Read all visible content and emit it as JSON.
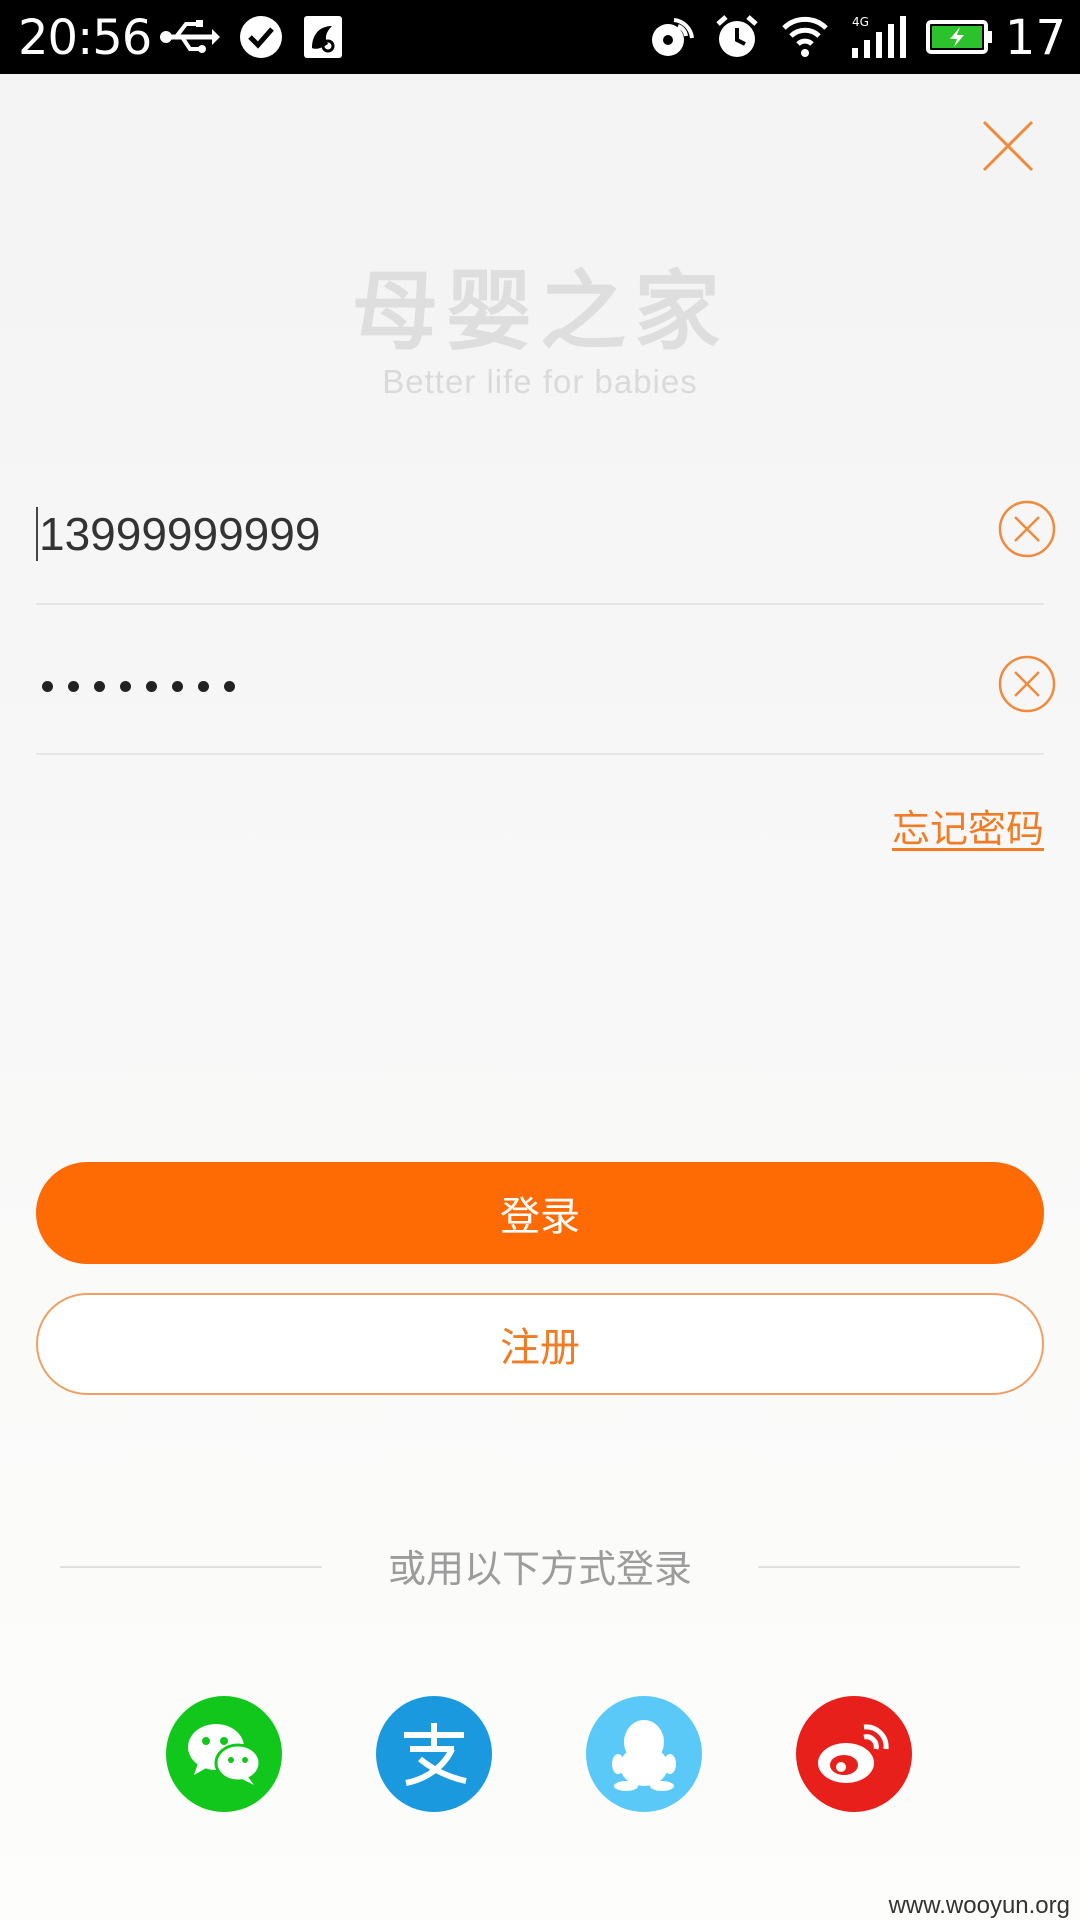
{
  "status_bar": {
    "time": "20:56",
    "battery_level": "17",
    "icons": [
      "usb-icon",
      "check-icon",
      "app-notification-icon",
      "rotate-icon",
      "alarm-icon",
      "wifi-icon",
      "signal-4g-icon",
      "battery-charging-icon"
    ]
  },
  "logo": {
    "title": "母婴之家",
    "tagline": "Better life for babies"
  },
  "form": {
    "phone_value": "13999999999",
    "password_mask_count": 8,
    "forgot_password": "忘记密码"
  },
  "buttons": {
    "login": "登录",
    "register": "注册"
  },
  "alt_login": {
    "label": "或用以下方式登录",
    "providers": [
      "wechat-icon",
      "alipay-icon",
      "qq-icon",
      "weibo-icon"
    ]
  },
  "watermark": "www.wooyun.org",
  "colors": {
    "accent": "#fe6a04",
    "accent_text": "#f07c25",
    "wechat": "#12c71b",
    "alipay": "#1b99de",
    "qq": "#5bc9f7",
    "weibo": "#e8201b"
  }
}
